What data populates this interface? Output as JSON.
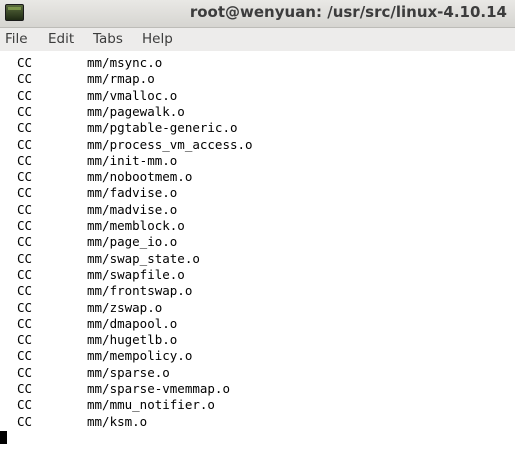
{
  "window": {
    "title": "root@wenyuan: /usr/src/linux-4.10.14",
    "icon": "terminal-icon"
  },
  "menu": {
    "items": [
      "File",
      "Edit",
      "Tabs",
      "Help"
    ]
  },
  "terminal": {
    "lines": [
      {
        "tag": "CC",
        "path": "mm/msync.o"
      },
      {
        "tag": "CC",
        "path": "mm/rmap.o"
      },
      {
        "tag": "CC",
        "path": "mm/vmalloc.o"
      },
      {
        "tag": "CC",
        "path": "mm/pagewalk.o"
      },
      {
        "tag": "CC",
        "path": "mm/pgtable-generic.o"
      },
      {
        "tag": "CC",
        "path": "mm/process_vm_access.o"
      },
      {
        "tag": "CC",
        "path": "mm/init-mm.o"
      },
      {
        "tag": "CC",
        "path": "mm/nobootmem.o"
      },
      {
        "tag": "CC",
        "path": "mm/fadvise.o"
      },
      {
        "tag": "CC",
        "path": "mm/madvise.o"
      },
      {
        "tag": "CC",
        "path": "mm/memblock.o"
      },
      {
        "tag": "CC",
        "path": "mm/page_io.o"
      },
      {
        "tag": "CC",
        "path": "mm/swap_state.o"
      },
      {
        "tag": "CC",
        "path": "mm/swapfile.o"
      },
      {
        "tag": "CC",
        "path": "mm/frontswap.o"
      },
      {
        "tag": "CC",
        "path": "mm/zswap.o"
      },
      {
        "tag": "CC",
        "path": "mm/dmapool.o"
      },
      {
        "tag": "CC",
        "path": "mm/hugetlb.o"
      },
      {
        "tag": "CC",
        "path": "mm/mempolicy.o"
      },
      {
        "tag": "CC",
        "path": "mm/sparse.o"
      },
      {
        "tag": "CC",
        "path": "mm/sparse-vmemmap.o"
      },
      {
        "tag": "CC",
        "path": "mm/mmu_notifier.o"
      },
      {
        "tag": "CC",
        "path": "mm/ksm.o"
      }
    ]
  }
}
